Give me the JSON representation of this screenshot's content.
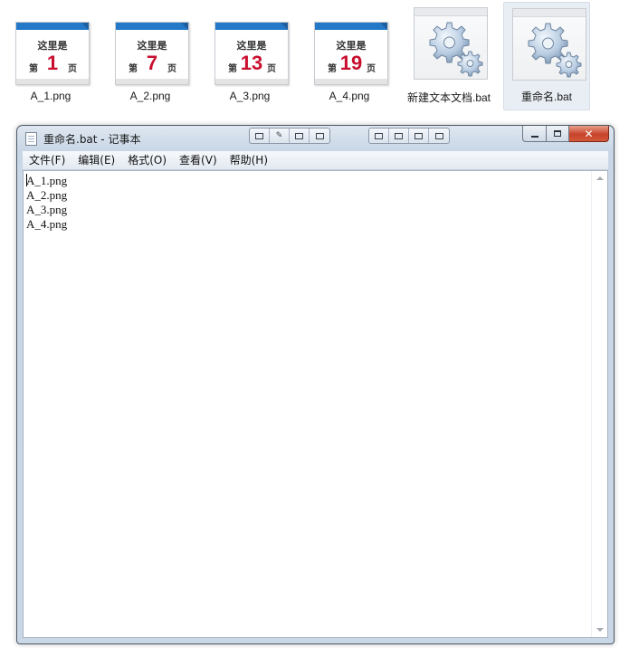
{
  "files": [
    {
      "name": "A_1.png",
      "thumb": {
        "title": "这里是",
        "prefix": "第",
        "number": "1",
        "suffix": "页"
      }
    },
    {
      "name": "A_2.png",
      "thumb": {
        "title": "这里是",
        "prefix": "第",
        "number": "7",
        "suffix": "页"
      }
    },
    {
      "name": "A_3.png",
      "thumb": {
        "title": "这里是",
        "prefix": "第",
        "number": "13",
        "suffix": "页"
      }
    },
    {
      "name": "A_4.png",
      "thumb": {
        "title": "这里是",
        "prefix": "第",
        "number": "19",
        "suffix": "页"
      }
    },
    {
      "name": "新建文本文档.bat",
      "icon": "batch-gear-icon"
    },
    {
      "name": "重命名.bat",
      "icon": "batch-gear-icon",
      "selected": true
    }
  ],
  "window": {
    "title": "重命名.bat - 记事本",
    "menu": [
      "文件(F)",
      "编辑(E)",
      "格式(O)",
      "查看(V)",
      "帮助(H)"
    ],
    "caption": {
      "close": "✕"
    }
  },
  "editor": {
    "lines": [
      "A_1.png",
      "A_2.png",
      "A_3.png",
      "A_4.png"
    ]
  },
  "colors": {
    "thumb_accent": "#2478c8",
    "number_red": "#c8102e",
    "close_red": "#c7432a"
  }
}
